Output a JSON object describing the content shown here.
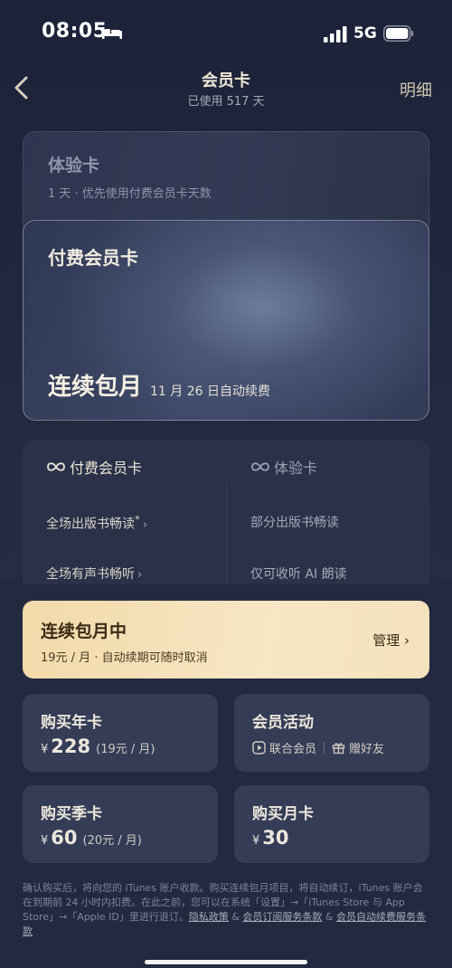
{
  "status_bar": {
    "time": "08:05",
    "network": "5G"
  },
  "nav": {
    "title": "会员卡",
    "subtitle": "已使用 517 天",
    "detail_label": "明细"
  },
  "trial_card": {
    "title": "体验卡",
    "desc": "1 天 · 优先使用付费会员卡天数"
  },
  "paid_card": {
    "title": "付费会员卡",
    "plan": "连续包月",
    "renew": "11 月 26 日自动续费"
  },
  "comparison": {
    "paid_header": "付费会员卡",
    "trial_header": "体验卡",
    "paid_features": [
      "全场出版书畅读",
      "全场有声书畅听"
    ],
    "trial_features": [
      "部分出版书畅读",
      "仅可收听 AI 朗读"
    ],
    "paid_feature_mark": "*",
    "chevron": "›"
  },
  "subscription": {
    "title": "连续包月中",
    "desc": "19元 / 月 · 自动续期可随时取消",
    "manage_label": "管理 ›"
  },
  "products": {
    "annual": {
      "title": "购买年卡",
      "currency": "¥",
      "price": "228",
      "per": "(19元 / 月)"
    },
    "activity": {
      "title": "会员活动",
      "link1": "联合会员",
      "link2": "赠好友"
    },
    "quarterly": {
      "title": "购买季卡",
      "currency": "¥",
      "price": "60",
      "per": "(20元 / 月)"
    },
    "monthly": {
      "title": "购买月卡",
      "currency": "¥",
      "price": "30"
    }
  },
  "footer": {
    "text1": "确认购买后，将向您的 iTunes 账户收款。购买连续包月项目，将自动续订，iTunes 账户会在到期前 24 小时内扣费。在此之前，您可以在系统「设置」→「iTunes Store 与 App Store」→「Apple ID」里进行退订。",
    "privacy_link": "隐私政策",
    "amp1": " & ",
    "member_terms_link": "会员订阅服务条款",
    "amp2": " & ",
    "auto_renew_link": "会员自动续费服务条款"
  }
}
